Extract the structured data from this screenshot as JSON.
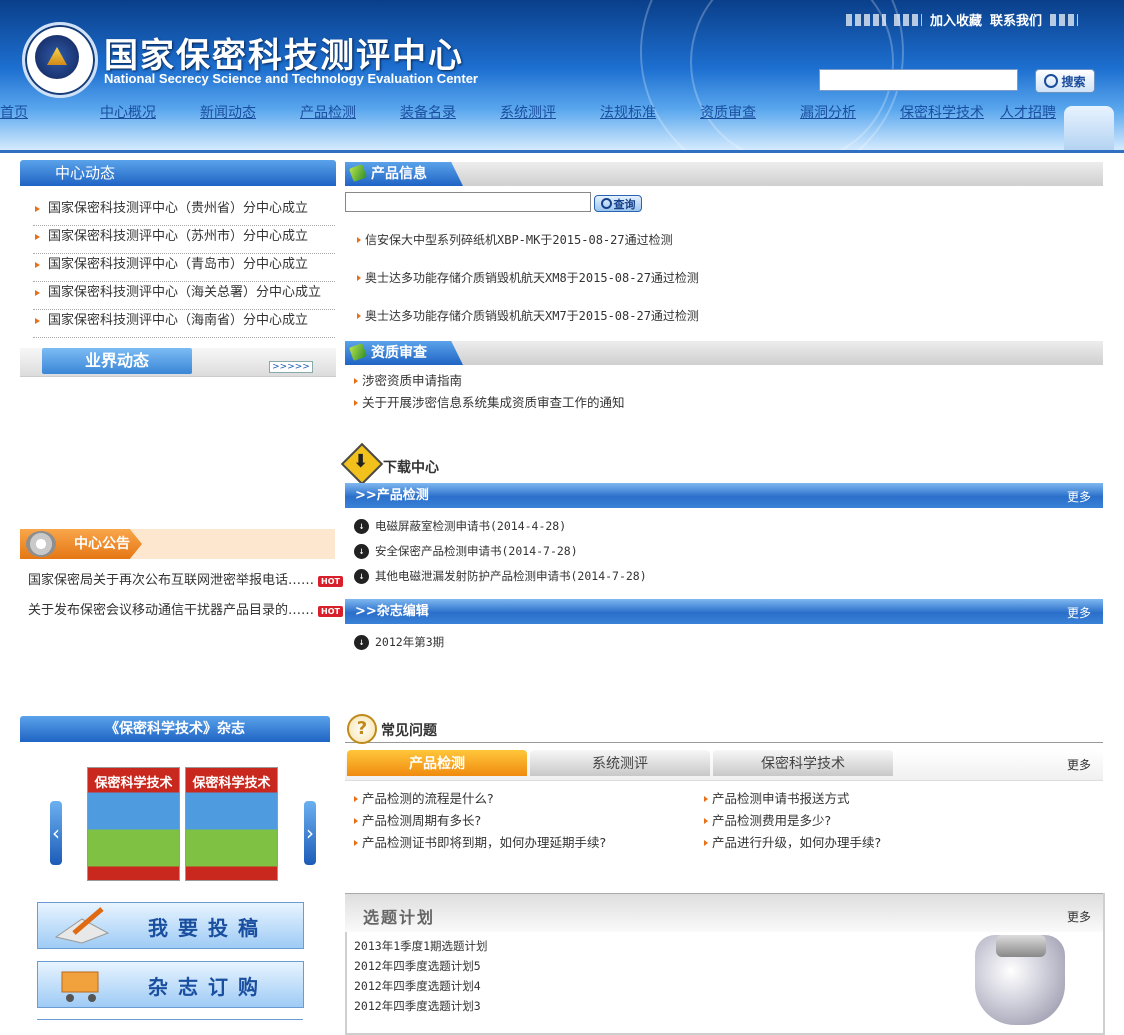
{
  "header": {
    "title_cn": "国家保密科技测评中心",
    "title_en": "National Secrecy Science and Technology Evaluation Center",
    "toplinks": [
      "加入收藏",
      "联系我们"
    ],
    "search_button": "搜索"
  },
  "nav": [
    "首页",
    "中心概况",
    "新闻动态",
    "产品检测",
    "装备名录",
    "系统测评",
    "法规标准",
    "资质审查",
    "漏洞分析",
    "保密科学技术",
    "人才招聘"
  ],
  "center_news": {
    "title": "中心动态",
    "items": [
      "国家保密科技测评中心（贵州省）分中心成立",
      "国家保密科技测评中心（苏州市）分中心成立",
      "国家保密科技测评中心（青岛市）分中心成立",
      "国家保密科技测评中心（海关总署）分中心成立",
      "国家保密科技测评中心（海南省）分中心成立"
    ]
  },
  "industry": {
    "title": "业界动态",
    "more": ">>>>>"
  },
  "notice": {
    "title": "中心公告",
    "hot_badge": "HOT",
    "items": [
      "国家保密局关于再次公布互联网泄密举报电话……",
      "关于发布保密会议移动通信干扰器产品目录的……"
    ]
  },
  "magazine": {
    "title": "《保密科学技术》杂志",
    "cover_title": "保密科学技术",
    "submit_button": "我要投稿",
    "order_button": "杂志订购"
  },
  "product_info": {
    "title": "产品信息",
    "query_button": "查询",
    "items": [
      "信安保大中型系列碎纸机XBP-MK于2015-08-27通过检测",
      "奥士达多功能存储介质销毁机航天XM8于2015-08-27通过检测",
      "奥士达多功能存储介质销毁机航天XM7于2015-08-27通过检测"
    ]
  },
  "qualification": {
    "title": "资质审查",
    "items": [
      "涉密资质申请指南",
      "关于开展涉密信息系统集成资质审查工作的通知"
    ]
  },
  "download": {
    "title": "下载中心",
    "more": "更多",
    "sections": [
      {
        "title": ">>产品检测",
        "items": [
          "电磁屏蔽室检测申请书(2014-4-28)",
          "安全保密产品检测申请书(2014-7-28)",
          "其他电磁泄漏发射防护产品检测申请书(2014-7-28)"
        ]
      },
      {
        "title": ">>杂志编辑",
        "items": [
          "2012年第3期"
        ]
      }
    ]
  },
  "faq": {
    "title": "常见问题",
    "tabs": [
      "产品检测",
      "系统测评",
      "保密科学技术"
    ],
    "more": "更多",
    "left": [
      "产品检测的流程是什么?",
      "产品检测周期有多长?",
      "产品检测证书即将到期，如何办理延期手续?"
    ],
    "right": [
      "产品检测申请书报送方式",
      "产品检测费用是多少?",
      "产品进行升级，如何办理手续?"
    ]
  },
  "topic_plan": {
    "title": "选题计划",
    "more": "更多",
    "items": [
      "2013年1季度1期选题计划",
      "2012年四季度选题计划5",
      "2012年四季度选题计划4",
      "2012年四季度选题计划3"
    ]
  }
}
